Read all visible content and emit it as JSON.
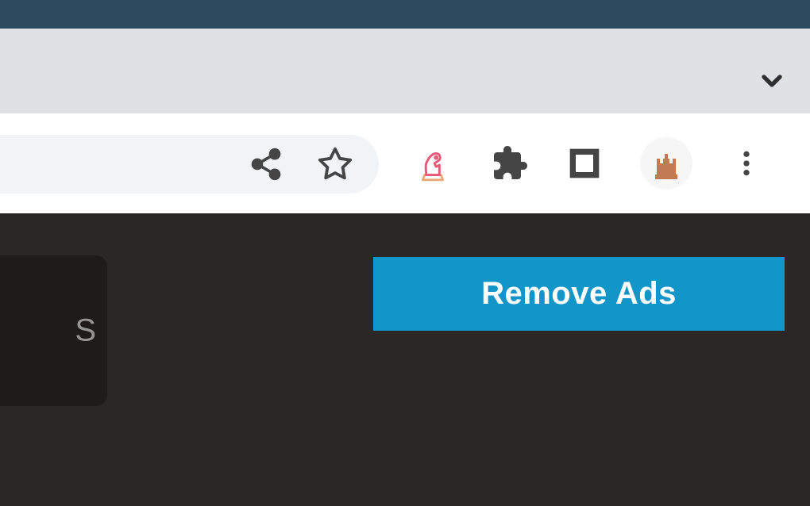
{
  "titlebar": {},
  "tabstrip": {},
  "toolbar": {
    "share_icon": "share",
    "bookmark_icon": "star",
    "chess_icon": "knight",
    "extensions_icon": "puzzle",
    "reader_icon": "square",
    "profile_icon": "castle",
    "menu_icon": "kebab"
  },
  "content": {
    "side_panel_text": "S",
    "remove_ads_label": "Remove Ads"
  }
}
